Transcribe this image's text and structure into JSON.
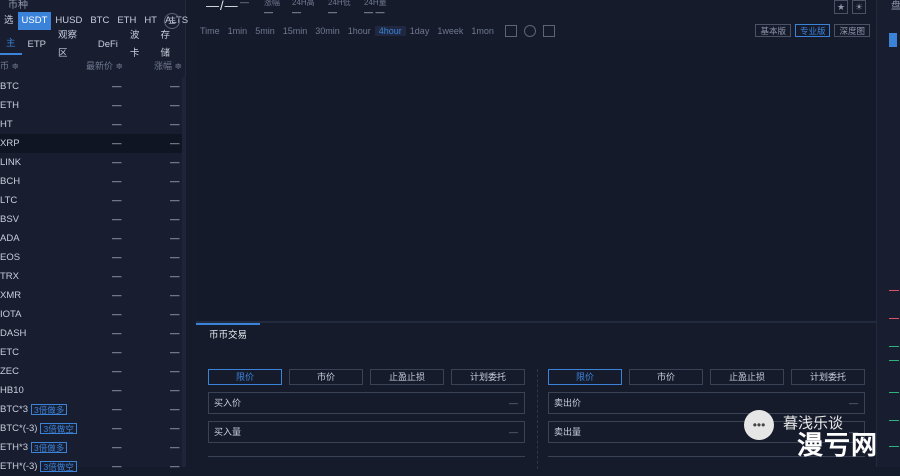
{
  "left": {
    "title": "币种",
    "quote_tabs": [
      "选",
      "USDT",
      "HUSD",
      "BTC",
      "ETH",
      "HT",
      "ALTS"
    ],
    "active_quote": "USDT",
    "cat_tabs": [
      "主",
      "ETP",
      "观察区",
      "DeFi",
      "波卡",
      "存储"
    ],
    "head": {
      "symbol": "币 ≑",
      "price": "最新价 ≑",
      "change": "涨幅 ≑"
    },
    "rows": [
      {
        "sym": "BTC",
        "price": "—",
        "chg": "—"
      },
      {
        "sym": "ETH",
        "price": "—",
        "chg": "—"
      },
      {
        "sym": "HT",
        "price": "—",
        "chg": "—"
      },
      {
        "sym": "XRP",
        "price": "—",
        "chg": "—"
      },
      {
        "sym": "LINK",
        "price": "—",
        "chg": "—"
      },
      {
        "sym": "BCH",
        "price": "—",
        "chg": "—"
      },
      {
        "sym": "LTC",
        "price": "—",
        "chg": "—"
      },
      {
        "sym": "BSV",
        "price": "—",
        "chg": "—"
      },
      {
        "sym": "ADA",
        "price": "—",
        "chg": "—"
      },
      {
        "sym": "EOS",
        "price": "—",
        "chg": "—"
      },
      {
        "sym": "TRX",
        "price": "—",
        "chg": "—"
      },
      {
        "sym": "XMR",
        "price": "—",
        "chg": "—"
      },
      {
        "sym": "IOTA",
        "price": "—",
        "chg": "—"
      },
      {
        "sym": "DASH",
        "price": "—",
        "chg": "—"
      },
      {
        "sym": "ETC",
        "price": "—",
        "chg": "—"
      },
      {
        "sym": "ZEC",
        "price": "—",
        "chg": "—"
      },
      {
        "sym": "HB10",
        "price": "—",
        "chg": "—"
      },
      {
        "sym": "BTC*3",
        "tag": "3倍做多",
        "price": "—",
        "chg": "—"
      },
      {
        "sym": "BTC*(-3)",
        "tag": "3倍做空",
        "price": "—",
        "chg": "—"
      },
      {
        "sym": "ETH*3",
        "tag": "3倍做多",
        "price": "—",
        "chg": "—"
      },
      {
        "sym": "ETH*(-3)",
        "tag": "3倍做空",
        "price": "—",
        "chg": "—"
      }
    ]
  },
  "top": {
    "price": "—/—",
    "sub": "—",
    "stats": [
      {
        "label": "涨幅",
        "value": "—"
      },
      {
        "label": "24H高",
        "value": "—"
      },
      {
        "label": "24H低",
        "value": "—"
      },
      {
        "label": "24H量",
        "value": "— —"
      }
    ]
  },
  "intervals": [
    "Time",
    "1min",
    "5min",
    "15min",
    "30min",
    "1hour",
    "4hour",
    "1day",
    "1week",
    "1mon"
  ],
  "active_interval": "4hour",
  "view_buttons": [
    "基本版",
    "专业版",
    "深度图"
  ],
  "active_view": "专业版",
  "trade": {
    "tab": "币币交易",
    "order_types": [
      "限价",
      "市价",
      "止盈止损",
      "计划委托"
    ],
    "buy_price": "买入价",
    "buy_amount": "买入量",
    "sell_price": "卖出价",
    "sell_amount": "卖出量",
    "dash": "—"
  },
  "right": {
    "title": "盘"
  },
  "watermark": {
    "icon": "•••",
    "line1": "暮浅乐谈",
    "line2": "漫亏网"
  },
  "colors": {
    "accent": "#3b82d9",
    "bg": "#161b2b"
  }
}
